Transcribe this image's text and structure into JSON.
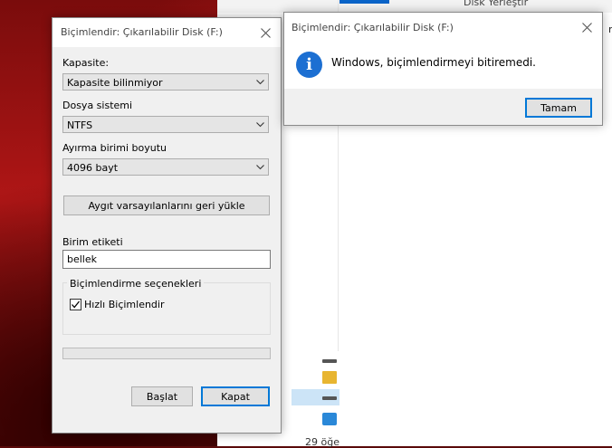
{
  "background_window": {
    "peek_label_top": "Disk Yerleştir",
    "peek_label_right": "ra",
    "nav_date": "29 öğe"
  },
  "format_dialog": {
    "title": "Biçimlendir: Çıkarılabilir Disk (F:)",
    "capacity_label": "Kapasite:",
    "capacity_value": "Kapasite bilinmiyor",
    "filesystem_label": "Dosya sistemi",
    "filesystem_value": "NTFS",
    "allocation_label": "Ayırma birimi boyutu",
    "allocation_value": "4096 bayt",
    "restore_defaults_label": "Aygıt varsayılanlarını geri yükle",
    "volume_label_label": "Birim etiketi",
    "volume_label_value": "bellek",
    "options_group_label": "Biçimlendirme seçenekleri",
    "quick_format_label": "Hızlı Biçimlendir",
    "quick_format_checked": true,
    "progress": 0,
    "start_label": "Başlat",
    "close_label": "Kapat"
  },
  "message_box": {
    "title": "Biçimlendir: Çıkarılabilir Disk (F:)",
    "message": "Windows, biçimlendirmeyi bitiremedi.",
    "icon": "info-icon",
    "ok_label": "Tamam"
  },
  "colors": {
    "accent": "#0078d7",
    "info_icon": "#1c6fd2",
    "desktop": "#b01616"
  }
}
